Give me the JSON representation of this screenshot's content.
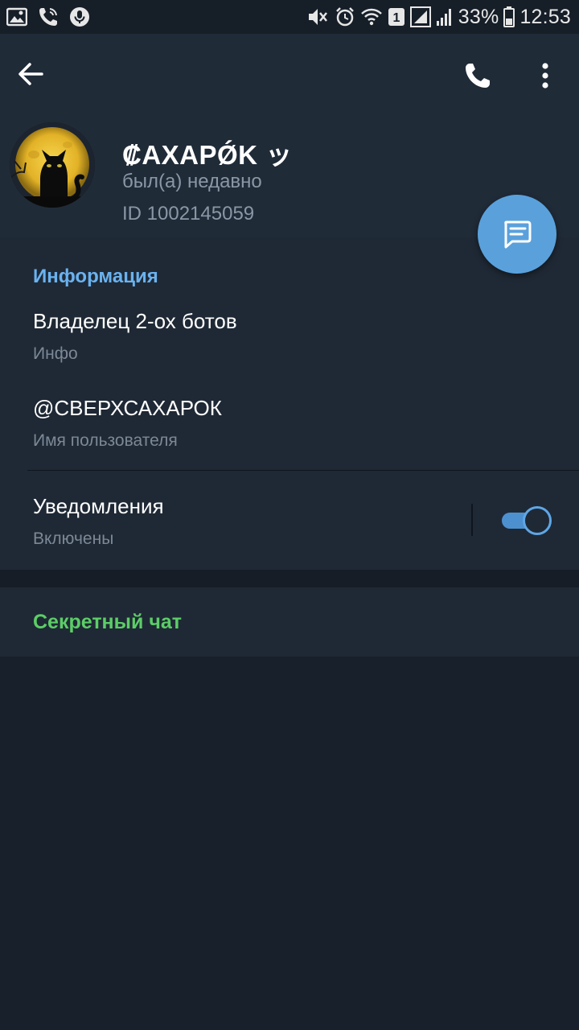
{
  "status_bar": {
    "battery_percent": "33%",
    "time": "12:53",
    "sim_badge": "1"
  },
  "header": {
    "name": "₡ΑΧΑΡǾΚ ッ",
    "last_seen": "был(а) недавно",
    "user_id": "ID 1002145059"
  },
  "info": {
    "section_title": "Информация",
    "bio_value": "Владелец 2-ох ботов",
    "bio_label": "Инфо",
    "username_value": "@СВЕРХСАХАРОК",
    "username_label": "Имя пользователя",
    "notifications_value": "Уведомления",
    "notifications_state": "Включены",
    "notifications_enabled": true
  },
  "secret_chat": {
    "label": "Секретный чат"
  },
  "colors": {
    "accent_blue": "#6ab2ef",
    "secret_green": "#5ccd67",
    "fab_blue": "#5aa1dc",
    "header_bg": "#202b38",
    "page_bg": "#18202b"
  }
}
